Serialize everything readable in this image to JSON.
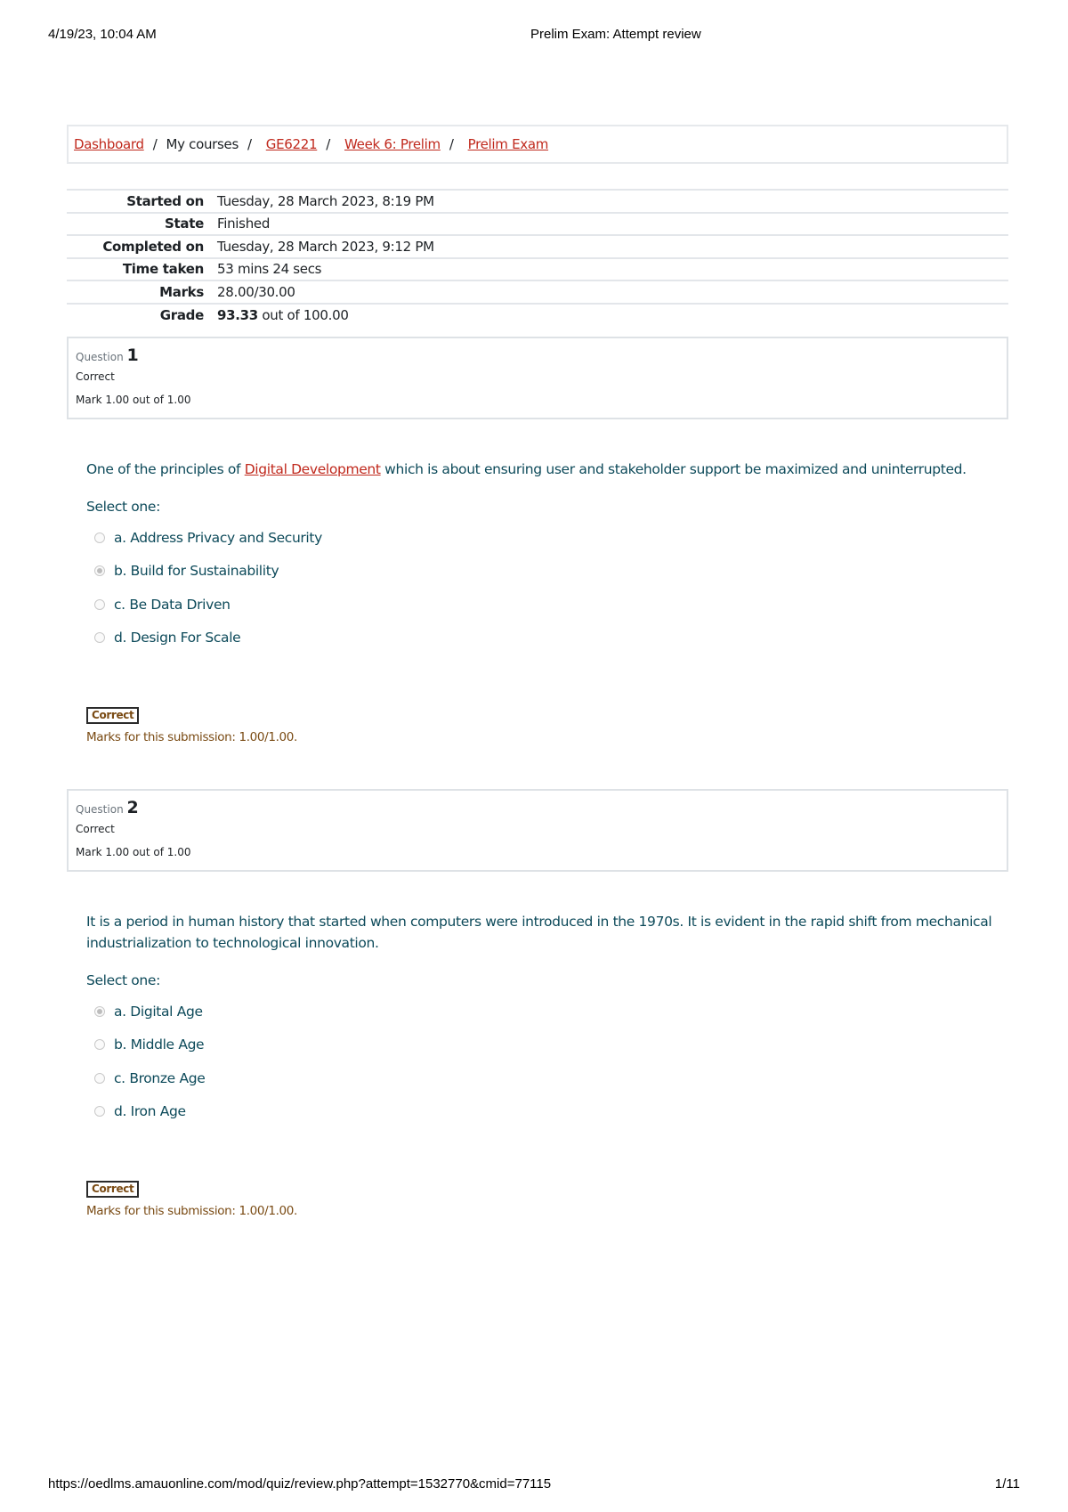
{
  "print_header": {
    "datetime": "4/19/23, 10:04 AM",
    "title": "Prelim Exam: Attempt review"
  },
  "breadcrumb": {
    "items": [
      {
        "label": "Dashboard",
        "link": true
      },
      {
        "label": "My courses",
        "link": false
      },
      {
        "label": "GE6221",
        "link": true
      },
      {
        "label": "Week 6: Prelim",
        "link": true
      },
      {
        "label": "Prelim Exam",
        "link": true
      }
    ],
    "separator": "/"
  },
  "summary": {
    "rows": [
      {
        "label": "Started on",
        "value": "Tuesday, 28 March 2023, 8:19 PM"
      },
      {
        "label": "State",
        "value": "Finished"
      },
      {
        "label": "Completed on",
        "value": "Tuesday, 28 March 2023, 9:12 PM"
      },
      {
        "label": "Time taken",
        "value": "53 mins 24 secs"
      },
      {
        "label": "Marks",
        "value": "28.00/30.00"
      },
      {
        "label": "Grade",
        "value_bold": "93.33",
        "value": " out of 100.00"
      }
    ]
  },
  "questions": [
    {
      "label": "Question",
      "number": "1",
      "state": "Correct",
      "grade": "Mark 1.00 out of 1.00",
      "text_before": "One of the principles of ",
      "text_link": "Digital Development",
      "text_after": " which is about ensuring user and stakeholder support be maximized and uninterrupted.",
      "prompt": "Select one:",
      "options": [
        {
          "label": "a. Address Privacy and Security",
          "selected": false
        },
        {
          "label": "b. Build for Sustainability",
          "selected": true
        },
        {
          "label": "c. Be Data Driven",
          "selected": false
        },
        {
          "label": "d. Design For Scale",
          "selected": false
        }
      ],
      "outcome_badge": "Correct",
      "marks_line": "Marks for this submission: 1.00/1.00."
    },
    {
      "label": "Question",
      "number": "2",
      "state": "Correct",
      "grade": "Mark 1.00 out of 1.00",
      "text_before": "It is a period in human history that started when computers were introduced in the 1970s. It is evident in the rapid shift from mechanical industrialization to technological innovation.",
      "text_link": "",
      "text_after": "",
      "prompt": "Select one:",
      "options": [
        {
          "label": "a. Digital Age",
          "selected": true
        },
        {
          "label": "b. Middle Age",
          "selected": false
        },
        {
          "label": "c. Bronze Age",
          "selected": false
        },
        {
          "label": "d. Iron Age",
          "selected": false
        }
      ],
      "outcome_badge": "Correct",
      "marks_line": "Marks for this submission: 1.00/1.00."
    }
  ],
  "print_footer": {
    "url": "https://oedlms.amauonline.com/mod/quiz/review.php?attempt=1532770&cmid=77115",
    "page": "1/11"
  },
  "colors": {
    "link": "#c0291d",
    "question_text": "#0d4a5a",
    "feedback": "#7a4b14"
  }
}
